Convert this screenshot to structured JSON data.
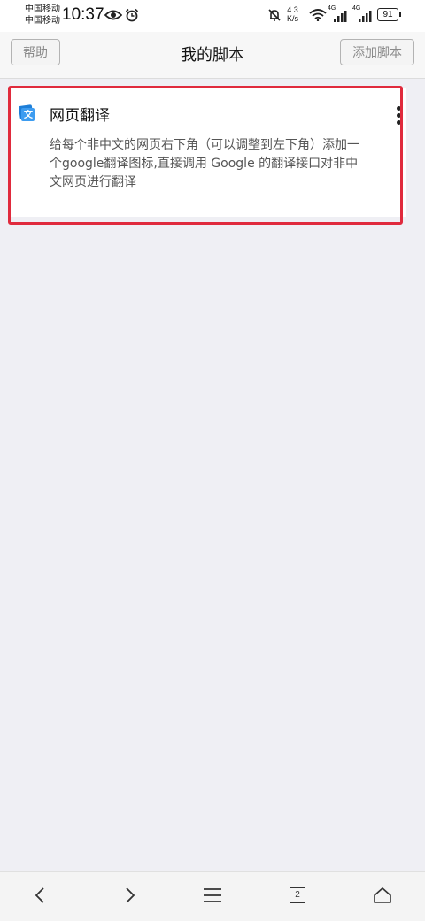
{
  "status_bar": {
    "carrier_1": "中国移动",
    "carrier_2": "中国移动",
    "time": "10:37",
    "network_speed_value": "4.3",
    "network_speed_unit": "K/s",
    "signal_label_1": "4G",
    "signal_label_2": "4G",
    "battery": "91",
    "icons": [
      "eye-icon",
      "alarm-icon",
      "mute-bell-icon",
      "wifi-icon",
      "signal-icon",
      "battery-icon"
    ]
  },
  "header": {
    "help_label": "帮助",
    "title": "我的脚本",
    "add_label": "添加脚本"
  },
  "scripts": [
    {
      "title": "网页翻译",
      "description": "给每个非中文的网页右下角（可以调整到左下角）添加一个google翻译图标,直接调用 Google 的翻译接口对非中文网页进行翻译",
      "icon": "translate-icon"
    }
  ],
  "bottom_nav": {
    "tab_count": "2",
    "icons": [
      "back-icon",
      "forward-icon",
      "menu-icon",
      "tabs-icon",
      "home-icon"
    ]
  },
  "colors": {
    "highlight": "#e02a3d",
    "icon_blue": "#1e7fd8",
    "background": "#efeff4"
  }
}
